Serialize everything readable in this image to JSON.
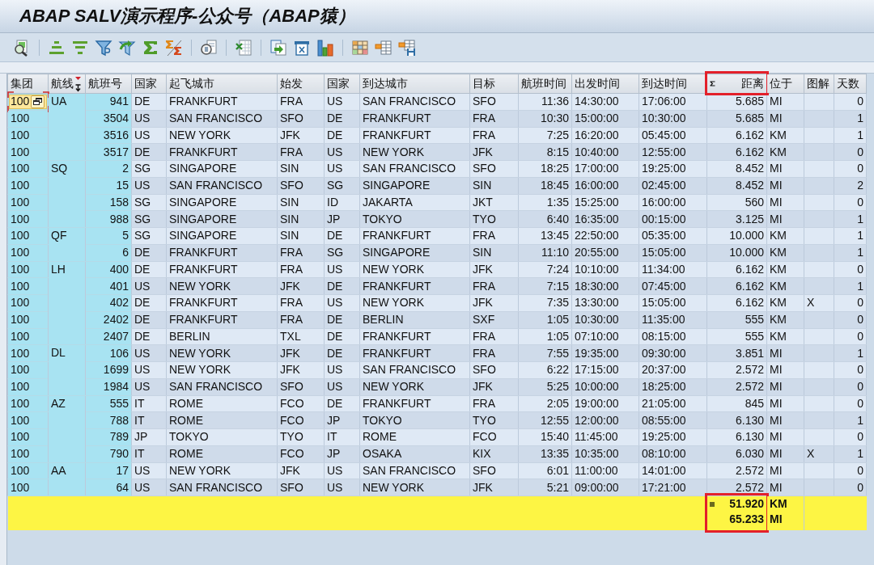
{
  "window": {
    "title": "ABAP SALV演示程序-公众号（ABAP猿）"
  },
  "table": {
    "columns": [
      {
        "label": "集团",
        "kind": "key",
        "sorted": false,
        "totaled": false,
        "highlighted": false
      },
      {
        "label": "航线",
        "kind": "key",
        "sorted": true,
        "totaled": false,
        "highlighted": false
      },
      {
        "label": "航班号",
        "kind": "key_number",
        "sorted": false,
        "totaled": false,
        "highlighted": false
      },
      {
        "label": "国家",
        "kind": "text",
        "sorted": false,
        "totaled": false,
        "highlighted": false
      },
      {
        "label": "起飞城市",
        "kind": "text",
        "sorted": false,
        "totaled": false,
        "highlighted": false
      },
      {
        "label": "始发",
        "kind": "text",
        "sorted": false,
        "totaled": false,
        "highlighted": false
      },
      {
        "label": "国家",
        "kind": "text",
        "sorted": false,
        "totaled": false,
        "highlighted": false
      },
      {
        "label": "到达城市",
        "kind": "text",
        "sorted": false,
        "totaled": false,
        "highlighted": false
      },
      {
        "label": "目标",
        "kind": "text",
        "sorted": false,
        "totaled": false,
        "highlighted": false
      },
      {
        "label": "航班时间",
        "kind": "number",
        "sorted": false,
        "totaled": false,
        "highlighted": false
      },
      {
        "label": "出发时间",
        "kind": "text",
        "sorted": false,
        "totaled": false,
        "highlighted": false
      },
      {
        "label": "到达时间",
        "kind": "text",
        "sorted": false,
        "totaled": false,
        "highlighted": false
      },
      {
        "label": "距离",
        "kind": "number",
        "sorted": false,
        "totaled": true,
        "highlighted": true
      },
      {
        "label": "位于",
        "kind": "text",
        "sorted": false,
        "totaled": false,
        "highlighted": false
      },
      {
        "label": "图解",
        "kind": "text",
        "sorted": false,
        "totaled": false,
        "highlighted": false
      },
      {
        "label": "天数",
        "kind": "number",
        "sorted": false,
        "totaled": false,
        "highlighted": false
      }
    ],
    "groups": [
      {
        "carrier": "UA",
        "flights": [
          {
            "client": "100",
            "flight_no": "941",
            "from_country": "DE",
            "from_city": "FRANKFURT",
            "from_airport": "FRA",
            "to_country": "US",
            "to_city": "SAN FRANCISCO",
            "to_airport": "SFO",
            "flight_time": "11:36",
            "departure": "14:30:00",
            "arrival": "17:06:00",
            "distance": "5.685",
            "unit": "MI",
            "days": "0",
            "focused": true
          },
          {
            "client": "100",
            "flight_no": "3504",
            "from_country": "US",
            "from_city": "SAN FRANCISCO",
            "from_airport": "SFO",
            "to_country": "DE",
            "to_city": "FRANKFURT",
            "to_airport": "FRA",
            "flight_time": "10:30",
            "departure": "15:00:00",
            "arrival": "10:30:00",
            "distance": "5.685",
            "unit": "MI",
            "days": "1",
            "focused": false
          },
          {
            "client": "100",
            "flight_no": "3516",
            "from_country": "US",
            "from_city": "NEW YORK",
            "from_airport": "JFK",
            "to_country": "DE",
            "to_city": "FRANKFURT",
            "to_airport": "FRA",
            "flight_time": "7:25",
            "departure": "16:20:00",
            "arrival": "05:45:00",
            "distance": "6.162",
            "unit": "KM",
            "days": "1",
            "focused": false
          },
          {
            "client": "100",
            "flight_no": "3517",
            "from_country": "DE",
            "from_city": "FRANKFURT",
            "from_airport": "FRA",
            "to_country": "US",
            "to_city": "NEW YORK",
            "to_airport": "JFK",
            "flight_time": "8:15",
            "departure": "10:40:00",
            "arrival": "12:55:00",
            "distance": "6.162",
            "unit": "KM",
            "days": "0",
            "focused": false
          }
        ]
      },
      {
        "carrier": "SQ",
        "flights": [
          {
            "client": "100",
            "flight_no": "2",
            "from_country": "SG",
            "from_city": "SINGAPORE",
            "from_airport": "SIN",
            "to_country": "US",
            "to_city": "SAN FRANCISCO",
            "to_airport": "SFO",
            "flight_time": "18:25",
            "departure": "17:00:00",
            "arrival": "19:25:00",
            "distance": "8.452",
            "unit": "MI",
            "days": "0",
            "focused": false
          },
          {
            "client": "100",
            "flight_no": "15",
            "from_country": "US",
            "from_city": "SAN FRANCISCO",
            "from_airport": "SFO",
            "to_country": "SG",
            "to_city": "SINGAPORE",
            "to_airport": "SIN",
            "flight_time": "18:45",
            "departure": "16:00:00",
            "arrival": "02:45:00",
            "distance": "8.452",
            "unit": "MI",
            "days": "2",
            "focused": false
          },
          {
            "client": "100",
            "flight_no": "158",
            "from_country": "SG",
            "from_city": "SINGAPORE",
            "from_airport": "SIN",
            "to_country": "ID",
            "to_city": "JAKARTA",
            "to_airport": "JKT",
            "flight_time": "1:35",
            "departure": "15:25:00",
            "arrival": "16:00:00",
            "distance": "560",
            "unit": "MI",
            "days": "0",
            "focused": false
          },
          {
            "client": "100",
            "flight_no": "988",
            "from_country": "SG",
            "from_city": "SINGAPORE",
            "from_airport": "SIN",
            "to_country": "JP",
            "to_city": "TOKYO",
            "to_airport": "TYO",
            "flight_time": "6:40",
            "departure": "16:35:00",
            "arrival": "00:15:00",
            "distance": "3.125",
            "unit": "MI",
            "days": "1",
            "focused": false
          }
        ]
      },
      {
        "carrier": "QF",
        "flights": [
          {
            "client": "100",
            "flight_no": "5",
            "from_country": "SG",
            "from_city": "SINGAPORE",
            "from_airport": "SIN",
            "to_country": "DE",
            "to_city": "FRANKFURT",
            "to_airport": "FRA",
            "flight_time": "13:45",
            "departure": "22:50:00",
            "arrival": "05:35:00",
            "distance": "10.000",
            "unit": "KM",
            "days": "1",
            "focused": false
          },
          {
            "client": "100",
            "flight_no": "6",
            "from_country": "DE",
            "from_city": "FRANKFURT",
            "from_airport": "FRA",
            "to_country": "SG",
            "to_city": "SINGAPORE",
            "to_airport": "SIN",
            "flight_time": "11:10",
            "departure": "20:55:00",
            "arrival": "15:05:00",
            "distance": "10.000",
            "unit": "KM",
            "days": "1",
            "focused": false
          }
        ]
      },
      {
        "carrier": "LH",
        "flights": [
          {
            "client": "100",
            "flight_no": "400",
            "from_country": "DE",
            "from_city": "FRANKFURT",
            "from_airport": "FRA",
            "to_country": "US",
            "to_city": "NEW YORK",
            "to_airport": "JFK",
            "flight_time": "7:24",
            "departure": "10:10:00",
            "arrival": "11:34:00",
            "distance": "6.162",
            "unit": "KM",
            "days": "0",
            "focused": false
          },
          {
            "client": "100",
            "flight_no": "401",
            "from_country": "US",
            "from_city": "NEW YORK",
            "from_airport": "JFK",
            "to_country": "DE",
            "to_city": "FRANKFURT",
            "to_airport": "FRA",
            "flight_time": "7:15",
            "departure": "18:30:00",
            "arrival": "07:45:00",
            "distance": "6.162",
            "unit": "KM",
            "days": "1",
            "focused": false
          },
          {
            "client": "100",
            "flight_no": "402",
            "from_country": "DE",
            "from_city": "FRANKFURT",
            "from_airport": "FRA",
            "to_country": "US",
            "to_city": "NEW YORK",
            "to_airport": "JFK",
            "flight_time": "7:35",
            "departure": "13:30:00",
            "arrival": "15:05:00",
            "distance": "6.162",
            "unit": "KM",
            "graphic": "X",
            "days": "0",
            "focused": false
          },
          {
            "client": "100",
            "flight_no": "2402",
            "from_country": "DE",
            "from_city": "FRANKFURT",
            "from_airport": "FRA",
            "to_country": "DE",
            "to_city": "BERLIN",
            "to_airport": "SXF",
            "flight_time": "1:05",
            "departure": "10:30:00",
            "arrival": "11:35:00",
            "distance": "555",
            "unit": "KM",
            "days": "0",
            "focused": false
          },
          {
            "client": "100",
            "flight_no": "2407",
            "from_country": "DE",
            "from_city": "BERLIN",
            "from_airport": "TXL",
            "to_country": "DE",
            "to_city": "FRANKFURT",
            "to_airport": "FRA",
            "flight_time": "1:05",
            "departure": "07:10:00",
            "arrival": "08:15:00",
            "distance": "555",
            "unit": "KM",
            "days": "0",
            "focused": false
          }
        ]
      },
      {
        "carrier": "DL",
        "flights": [
          {
            "client": "100",
            "flight_no": "106",
            "from_country": "US",
            "from_city": "NEW YORK",
            "from_airport": "JFK",
            "to_country": "DE",
            "to_city": "FRANKFURT",
            "to_airport": "FRA",
            "flight_time": "7:55",
            "departure": "19:35:00",
            "arrival": "09:30:00",
            "distance": "3.851",
            "unit": "MI",
            "days": "1",
            "focused": false
          },
          {
            "client": "100",
            "flight_no": "1699",
            "from_country": "US",
            "from_city": "NEW YORK",
            "from_airport": "JFK",
            "to_country": "US",
            "to_city": "SAN FRANCISCO",
            "to_airport": "SFO",
            "flight_time": "6:22",
            "departure": "17:15:00",
            "arrival": "20:37:00",
            "distance": "2.572",
            "unit": "MI",
            "days": "0",
            "focused": false
          },
          {
            "client": "100",
            "flight_no": "1984",
            "from_country": "US",
            "from_city": "SAN FRANCISCO",
            "from_airport": "SFO",
            "to_country": "US",
            "to_city": "NEW YORK",
            "to_airport": "JFK",
            "flight_time": "5:25",
            "departure": "10:00:00",
            "arrival": "18:25:00",
            "distance": "2.572",
            "unit": "MI",
            "days": "0",
            "focused": false
          }
        ]
      },
      {
        "carrier": "AZ",
        "flights": [
          {
            "client": "100",
            "flight_no": "555",
            "from_country": "IT",
            "from_city": "ROME",
            "from_airport": "FCO",
            "to_country": "DE",
            "to_city": "FRANKFURT",
            "to_airport": "FRA",
            "flight_time": "2:05",
            "departure": "19:00:00",
            "arrival": "21:05:00",
            "distance": "845",
            "unit": "MI",
            "days": "0",
            "focused": false
          },
          {
            "client": "100",
            "flight_no": "788",
            "from_country": "IT",
            "from_city": "ROME",
            "from_airport": "FCO",
            "to_country": "JP",
            "to_city": "TOKYO",
            "to_airport": "TYO",
            "flight_time": "12:55",
            "departure": "12:00:00",
            "arrival": "08:55:00",
            "distance": "6.130",
            "unit": "MI",
            "days": "1",
            "focused": false
          },
          {
            "client": "100",
            "flight_no": "789",
            "from_country": "JP",
            "from_city": "TOKYO",
            "from_airport": "TYO",
            "to_country": "IT",
            "to_city": "ROME",
            "to_airport": "FCO",
            "flight_time": "15:40",
            "departure": "11:45:00",
            "arrival": "19:25:00",
            "distance": "6.130",
            "unit": "MI",
            "days": "0",
            "focused": false
          },
          {
            "client": "100",
            "flight_no": "790",
            "from_country": "IT",
            "from_city": "ROME",
            "from_airport": "FCO",
            "to_country": "JP",
            "to_city": "OSAKA",
            "to_airport": "KIX",
            "flight_time": "13:35",
            "departure": "10:35:00",
            "arrival": "08:10:00",
            "distance": "6.030",
            "unit": "MI",
            "graphic": "X",
            "days": "1",
            "focused": false
          }
        ]
      },
      {
        "carrier": "AA",
        "flights": [
          {
            "client": "100",
            "flight_no": "17",
            "from_country": "US",
            "from_city": "NEW YORK",
            "from_airport": "JFK",
            "to_country": "US",
            "to_city": "SAN FRANCISCO",
            "to_airport": "SFO",
            "flight_time": "6:01",
            "departure": "11:00:00",
            "arrival": "14:01:00",
            "distance": "2.572",
            "unit": "MI",
            "days": "0",
            "focused": false
          },
          {
            "client": "100",
            "flight_no": "64",
            "from_country": "US",
            "from_city": "SAN FRANCISCO",
            "from_airport": "SFO",
            "to_country": "US",
            "to_city": "NEW YORK",
            "to_airport": "JFK",
            "flight_time": "5:21",
            "departure": "09:00:00",
            "arrival": "17:21:00",
            "distance": "2.572",
            "unit": "MI",
            "days": "0",
            "focused": false
          }
        ]
      }
    ],
    "totals": {
      "highlighted": true,
      "lines": [
        {
          "value": "51.920",
          "unit": "KM"
        },
        {
          "value": "65.233",
          "unit": "MI"
        }
      ]
    }
  }
}
